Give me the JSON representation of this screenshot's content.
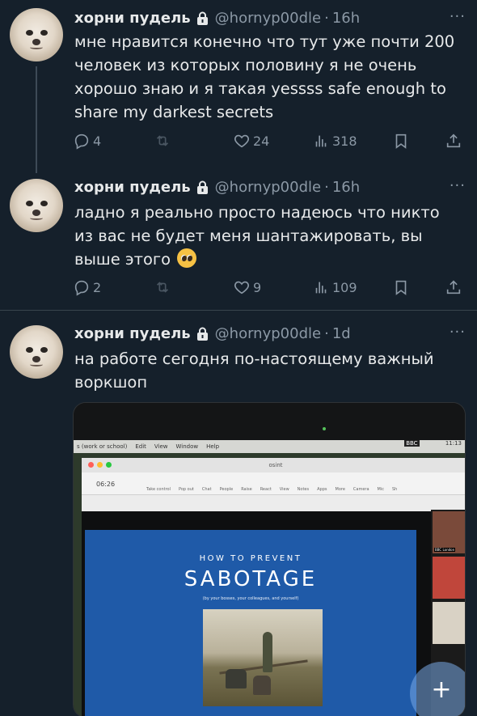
{
  "tweets": [
    {
      "name": "хорни пудель",
      "handle": "@hornyp00dle",
      "sep": "·",
      "time": "16h",
      "more": "···",
      "text": "мне нравится конечно что тут уже почти 200 человек из которых половину я не очень хорошо знаю и я такая yessss safe enough to share my darkest secrets",
      "replies": "4",
      "retweets": "",
      "likes": "24",
      "views": "318"
    },
    {
      "name": "хорни пудель",
      "handle": "@hornyp00dle",
      "sep": "·",
      "time": "16h",
      "more": "···",
      "text": "ладно я реально просто надеюсь что никто из вас не будет меня шантажировать, вы выше этого",
      "replies": "2",
      "retweets": "",
      "likes": "9",
      "views": "109"
    },
    {
      "name": "хорни пудель",
      "handle": "@hornyp00dle",
      "sep": "·",
      "time": "1d",
      "more": "···",
      "text": "на работе сегодня по-настоящему важный воркшоп"
    }
  ],
  "photo": {
    "menubar": [
      "s (work or school)",
      "Edit",
      "View",
      "Window",
      "Help"
    ],
    "menubar_right": "BBC",
    "clock": "11:13",
    "window_title": "osint",
    "timer": "06:26",
    "toolbar": [
      "Take control",
      "Pop out",
      "Chat",
      "People",
      "Raise",
      "React",
      "View",
      "Notes",
      "Apps",
      "More",
      "Camera",
      "Mic",
      "Sh"
    ],
    "slide_kicker": "HOW TO PREVENT",
    "slide_title": "SABOTAGE",
    "slide_subtitle": "(by your bosses, your colleagues, and yourself)",
    "tile_label": "BBC London",
    "fab": "+"
  },
  "colors": {
    "background": "#15202b",
    "text": "#e7e9ea",
    "muted": "#8b98a5",
    "divider": "#38444d",
    "slide": "#1f5aa8"
  }
}
